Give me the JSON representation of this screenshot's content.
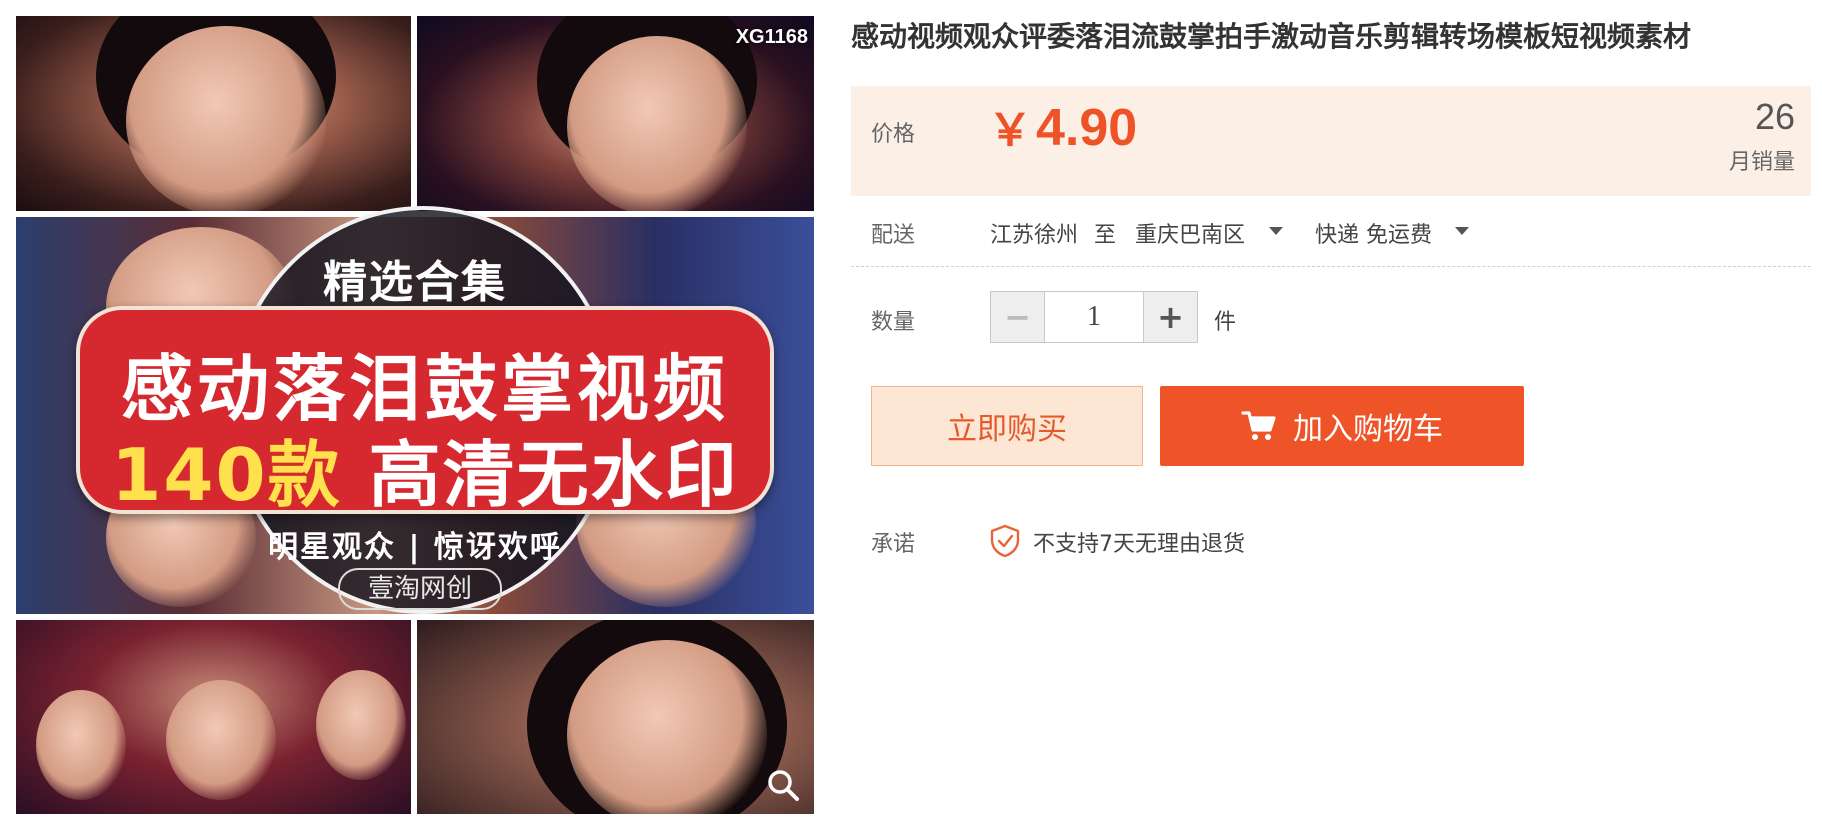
{
  "product": {
    "title": "感动视频观众评委落泪流鼓掌拍手激动音乐剪辑转场模板短视频素材",
    "image": {
      "watermark_code": "XG1168",
      "headline_small": "精选合集",
      "headline_line1": "感动落泪鼓掌视频",
      "headline_line2_count": "140款",
      "headline_line2_rest": "高清无水印",
      "tagline": "明星观众 | 惊讶欢呼",
      "brand": "壹淘网创",
      "zoom_icon": "magnifier-icon"
    }
  },
  "price": {
    "label": "价格",
    "currency": "￥",
    "amount": "4.90",
    "monthly_sales_value": "26",
    "monthly_sales_label": "月销量"
  },
  "shipping": {
    "label": "配送",
    "origin": "江苏徐州",
    "to_word": "至",
    "destination": "重庆巴南区",
    "method": "快递 免运费"
  },
  "quantity": {
    "label": "数量",
    "value": "1",
    "unit": "件",
    "minus": "−",
    "plus": "+"
  },
  "actions": {
    "buy_now": "立即购买",
    "add_to_cart": "加入购物车",
    "cart_icon": "cart-icon"
  },
  "promise": {
    "label": "承诺",
    "text": "不支持7天无理由退货",
    "icon": "shield-check-icon"
  },
  "colors": {
    "accent": "#ee5328",
    "price_bg": "#fcf0e6",
    "buy_bg": "#fde6d4"
  }
}
